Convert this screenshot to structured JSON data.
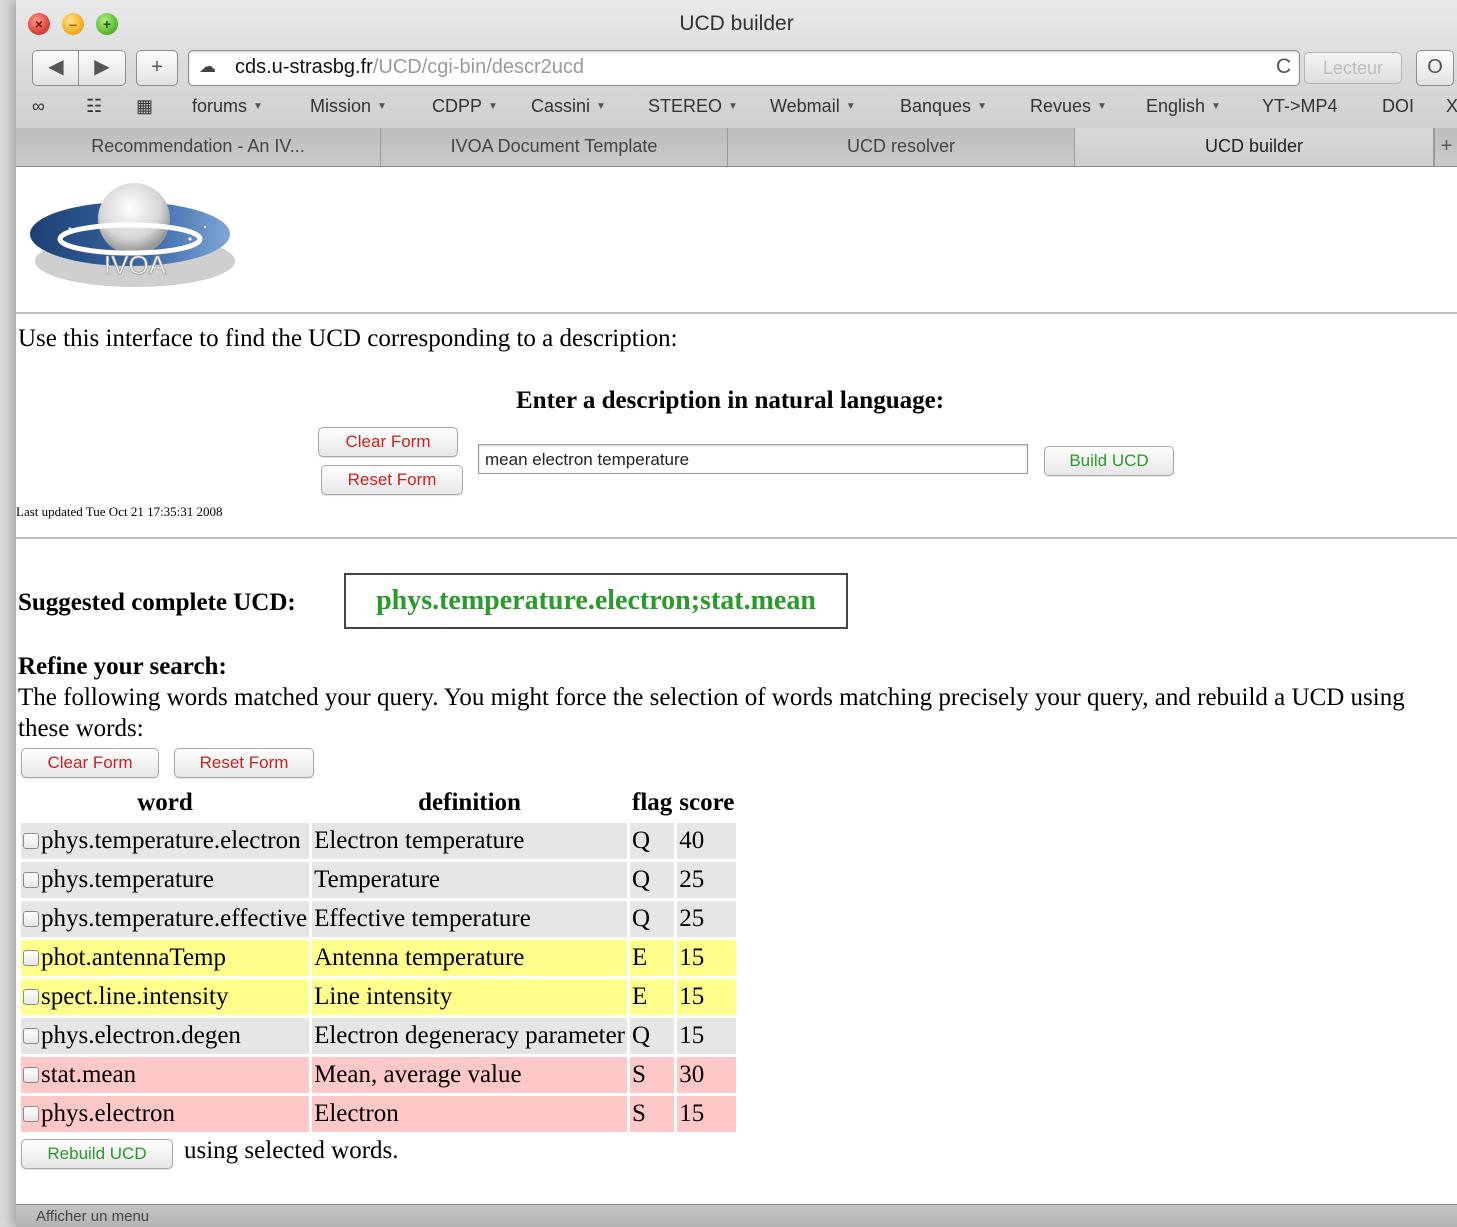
{
  "window": {
    "title": "UCD builder"
  },
  "toolbar": {
    "back": "◀",
    "forward": "▶",
    "add": "+",
    "url_host": "cds.u-strasbg.fr",
    "url_path": "/UCD/cgi-bin/descr2ucd",
    "reload": "C",
    "reader": "Lecteur",
    "extra": "O"
  },
  "bookmarks": {
    "icons": [
      "reading-list-icon",
      "book-icon",
      "grid-icon"
    ],
    "items": [
      "forums",
      "Mission",
      "CDPP",
      "Cassini",
      "STEREO",
      "Webmail",
      "Banques",
      "Revues",
      "English",
      "YT->MP4",
      "DOI",
      "X"
    ]
  },
  "tabs": [
    {
      "label": "Recommendation - An IV..."
    },
    {
      "label": "IVOA Document Template"
    },
    {
      "label": "UCD resolver"
    },
    {
      "label": "UCD builder",
      "active": true
    }
  ],
  "logo": {
    "text": "IVOA"
  },
  "page": {
    "intro": "Use this interface to find the UCD corresponding to a description:",
    "enter_title": "Enter a description in natural language:",
    "clear_form": "Clear Form",
    "reset_form": "Reset Form",
    "description_value": "mean electron temperature",
    "build_button": "Build UCD",
    "last_updated": "Last updated Tue Oct 21 17:35:31 2008",
    "suggested_label": "Suggested complete UCD:",
    "suggested_ucd": "phys.temperature.electron;stat.mean",
    "refine_title": "Refine your search:",
    "refine_text": "The following words matched your query. You might force the selection of words matching precisely your query, and rebuild a UCD using these words:",
    "refine_clear": "Clear Form",
    "refine_reset": "Reset Form",
    "rebuild_button": "Rebuild UCD",
    "rebuild_suffix": "using selected words."
  },
  "table": {
    "headers": [
      "word",
      "definition",
      "flag",
      "score"
    ],
    "rows": [
      {
        "word": "phys.temperature.electron",
        "definition": "Electron temperature",
        "flag": "Q",
        "score": "40",
        "kind": "q"
      },
      {
        "word": "phys.temperature",
        "definition": "Temperature",
        "flag": "Q",
        "score": "25",
        "kind": "q"
      },
      {
        "word": "phys.temperature.effective",
        "definition": "Effective temperature",
        "flag": "Q",
        "score": "25",
        "kind": "q"
      },
      {
        "word": "phot.antennaTemp",
        "definition": "Antenna temperature",
        "flag": "E",
        "score": "15",
        "kind": "e"
      },
      {
        "word": "spect.line.intensity",
        "definition": "Line intensity",
        "flag": "E",
        "score": "15",
        "kind": "e"
      },
      {
        "word": "phys.electron.degen",
        "definition": "Electron degeneracy parameter",
        "flag": "Q",
        "score": "15",
        "kind": "q"
      },
      {
        "word": "stat.mean",
        "definition": "Mean, average value",
        "flag": "S",
        "score": "30",
        "kind": "s"
      },
      {
        "word": "phys.electron",
        "definition": "Electron",
        "flag": "S",
        "score": "15",
        "kind": "s"
      }
    ]
  },
  "statusbar": {
    "text": "Afficher un menu"
  },
  "colors": {
    "ucd_green": "#2a9a2a",
    "button_red": "#cc1f1f",
    "row_q": "#e6e6e6",
    "row_e": "#ffff8c",
    "row_s": "#ffc8c8"
  }
}
